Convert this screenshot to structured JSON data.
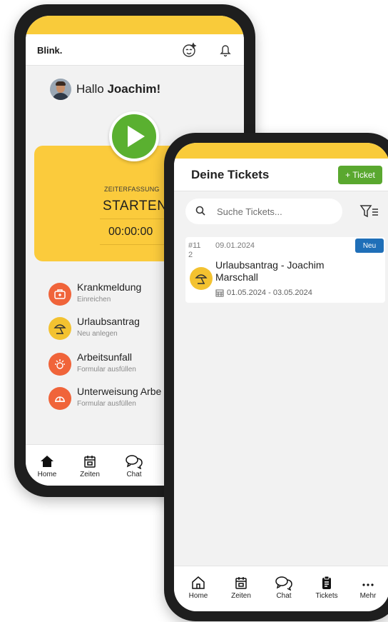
{
  "back_phone": {
    "logo": "Blink.",
    "greeting": {
      "prefix": "Hallo ",
      "name": "Joachim!"
    },
    "time_card": {
      "label": "ZEITERFASSUNG",
      "action": "STARTEN",
      "timer": "00:00:00"
    },
    "menu": [
      {
        "title": "Krankmeldung",
        "subtitle": "Einreichen",
        "icon": "first-aid-kit-icon",
        "color": "#f0643a"
      },
      {
        "title": "Urlaubsantrag",
        "subtitle": "Neu anlegen",
        "icon": "beach-umbrella-icon",
        "color": "#f3c230"
      },
      {
        "title": "Arbeitsunfall",
        "subtitle": "Formular ausfüllen",
        "icon": "accident-icon",
        "color": "#f0643a"
      },
      {
        "title": "Unterweisung Arbe",
        "subtitle": "Formular ausfüllen",
        "icon": "hard-hat-icon",
        "color": "#f0643a"
      }
    ],
    "nav": [
      {
        "label": "Home",
        "icon": "home-icon"
      },
      {
        "label": "Zeiten",
        "icon": "calendar-icon"
      },
      {
        "label": "Chat",
        "icon": "chat-icon"
      }
    ]
  },
  "front_phone": {
    "title": "Deine Tickets",
    "new_ticket_label": "+ Ticket",
    "search_placeholder": "Suche Tickets...",
    "tickets": [
      {
        "id": "#11 2",
        "date": "09.01.2024",
        "badge": "Neu",
        "title": "Urlaubsantrag - Joachim Marschall",
        "range": "01.05.2024 - 03.05.2024",
        "icon": "beach-umbrella-icon"
      }
    ],
    "nav": [
      {
        "label": "Home",
        "icon": "home-icon"
      },
      {
        "label": "Zeiten",
        "icon": "calendar-icon"
      },
      {
        "label": "Chat",
        "icon": "chat-icon"
      },
      {
        "label": "Tickets",
        "icon": "clipboard-icon"
      },
      {
        "label": "Mehr",
        "icon": "more-icon"
      }
    ]
  },
  "colors": {
    "accent_yellow": "#f9cb3a",
    "start_green": "#5ab030",
    "badge_blue": "#1f6fb8",
    "alert_orange": "#f0643a"
  }
}
